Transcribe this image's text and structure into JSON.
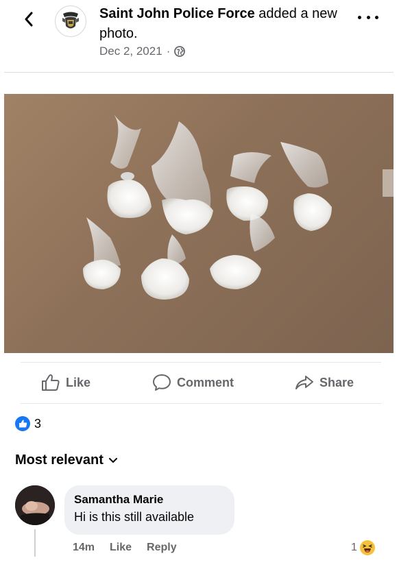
{
  "post": {
    "page_name": "Saint John Police Force",
    "action_text": " added a new photo.",
    "date": "Dec 2, 2021",
    "separator": "·",
    "privacy_icon": "globe-icon"
  },
  "actions": {
    "like": "Like",
    "comment": "Comment",
    "share": "Share"
  },
  "reactions": {
    "count": "3",
    "icon": "like-reaction-icon"
  },
  "comments_section": {
    "sort_label": "Most relevant"
  },
  "comments": [
    {
      "author": "Samantha Marie",
      "text": "Hi is this still available",
      "time": "14m",
      "like_label": "Like",
      "reply_label": "Reply",
      "reaction_count": "1",
      "reaction_icon": "haha-reaction-icon"
    }
  ],
  "colors": {
    "brand_blue": "#1877f2",
    "secondary_text": "#65676b",
    "bubble_bg": "#eef0f3"
  }
}
